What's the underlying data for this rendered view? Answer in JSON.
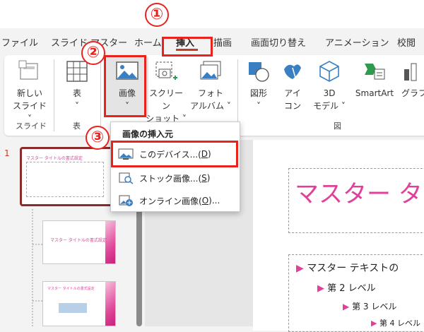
{
  "annotations": {
    "step1": "①",
    "step2": "②",
    "step3": "③"
  },
  "tabs": [
    {
      "label": "ファイル"
    },
    {
      "label": "スライド マスター"
    },
    {
      "label": "ホーム"
    },
    {
      "label": "挿入"
    },
    {
      "label": "描画"
    },
    {
      "label": "画面切り替え"
    },
    {
      "label": "アニメーション"
    },
    {
      "label": "校閲"
    }
  ],
  "ribbon": {
    "new_slide": {
      "line1": "新しい",
      "line2": "スライド ˅"
    },
    "table": {
      "line1": "表",
      "line2": "˅"
    },
    "image": {
      "line1": "画像",
      "line2": "˅"
    },
    "screenshot": {
      "line1": "スクリーン",
      "line2": "ショット ˅"
    },
    "photo_album": {
      "line1": "フォト",
      "line2": "アルバム ˅"
    },
    "shapes": {
      "line1": "図形",
      "line2": "˅"
    },
    "icons": {
      "line1": "アイ",
      "line2": "コン"
    },
    "model3d": {
      "line1": "3D",
      "line2": "モデル ˅"
    },
    "smartart": {
      "line1": "SmartArt"
    },
    "graph": {
      "line1": "グラフ"
    },
    "groups": {
      "slide": "スライド",
      "table": "表",
      "illust": "図"
    }
  },
  "menu": {
    "header": "画像の挿入元",
    "item1": {
      "text": "このデバイス...(",
      "key": "D",
      "end": ")"
    },
    "item2": {
      "text": "ストック画像...(",
      "key": "S",
      "end": ")"
    },
    "item3": {
      "text": "オンライン画像(",
      "key": "O",
      "end": ")..."
    }
  },
  "thumbnails": {
    "slide_number": "1",
    "t1": "マスター タイトルの書式設定",
    "t2": "マスター タイトルの書式設定",
    "t3": "マスター タイトルの書式設定"
  },
  "slide": {
    "title": "マスター タ",
    "bullets": [
      "マスター テキストの",
      "第 2 レベル",
      "第 3 レベル",
      "第 4 レベル"
    ]
  },
  "colors": {
    "accent": "#e8231e",
    "brand": "#c43e1c",
    "pink": "#e0409a"
  }
}
